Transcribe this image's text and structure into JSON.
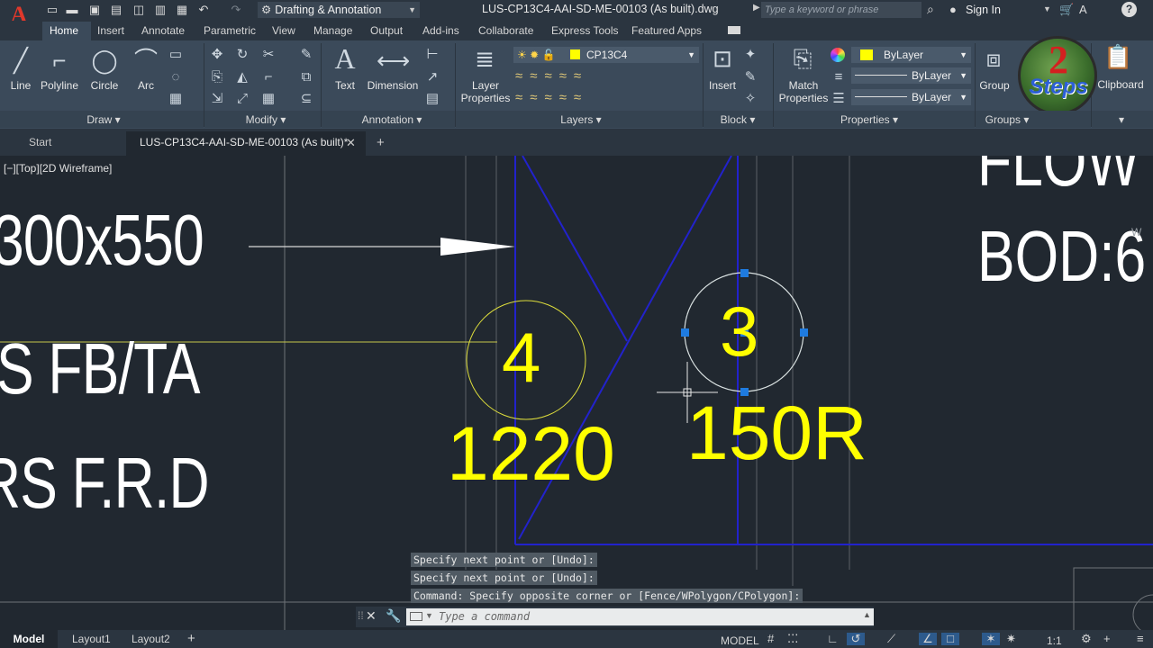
{
  "title_bar": {
    "workspace": "Drafting & Annotation",
    "document_title": "LUS-CP13C4-AAI-SD-ME-00103 (As built).dwg",
    "search_placeholder": "Type a keyword or phrase",
    "sign_in": "Sign In"
  },
  "ribbon_tabs": [
    "Home",
    "Insert",
    "Annotate",
    "Parametric",
    "View",
    "Manage",
    "Output",
    "Add-ins",
    "Collaborate",
    "Express Tools",
    "Featured Apps"
  ],
  "ribbon": {
    "draw": {
      "title": "Draw",
      "tools": [
        "Line",
        "Polyline",
        "Circle",
        "Arc"
      ]
    },
    "modify": {
      "title": "Modify"
    },
    "annotation": {
      "title": "Annotation",
      "tools": [
        "Text",
        "Dimension"
      ]
    },
    "layers": {
      "title": "Layers",
      "tool": "Layer Properties",
      "current_layer": "CP13C4",
      "layer_color": "#ffff00"
    },
    "block": {
      "title": "Block",
      "tool": "Insert"
    },
    "properties": {
      "title": "Properties",
      "tool_line1": "Match",
      "tool_line2": "Properties",
      "color": "ByLayer",
      "linetype": "ByLayer",
      "lineweight": "ByLayer",
      "color_swatch": "#ffff00"
    },
    "groups": {
      "title": "Groups",
      "tool": "Group"
    },
    "clipboard": {
      "tool": "Clipboard"
    }
  },
  "watermark": {
    "number": "2",
    "text": "Steps"
  },
  "file_tabs": {
    "start": "Start",
    "drawing": "LUS-CP13C4-AAI-SD-ME-00103 (As built)*"
  },
  "viewport_label": "[−][Top][2D Wireframe]",
  "drawing": {
    "text_size": "300x550",
    "text_fb": "S FB/TA",
    "text_frd": "RS F.R.D",
    "text_flow": "FLOW",
    "text_bod": "BOD:6",
    "text_w": "W",
    "tag4_number": "4",
    "tag4_value": "1220",
    "tag3_number": "3",
    "tag3_value": "150R"
  },
  "command_history": [
    "Specify next point or [Undo]:",
    "Specify next point or [Undo]:",
    "Command: Specify opposite corner or [Fence/WPolygon/CPolygon]:"
  ],
  "command_placeholder": "Type a command",
  "layout_tabs": [
    "Model",
    "Layout1",
    "Layout2"
  ],
  "status": {
    "space": "MODEL",
    "scale": "1:1"
  },
  "colors": {
    "app_accent": "#e0382b",
    "canvas": "#212830",
    "ribbon": "#3b4a5a",
    "annotation_yellow": "#ffff00",
    "geometry_blue": "#2222cc"
  }
}
